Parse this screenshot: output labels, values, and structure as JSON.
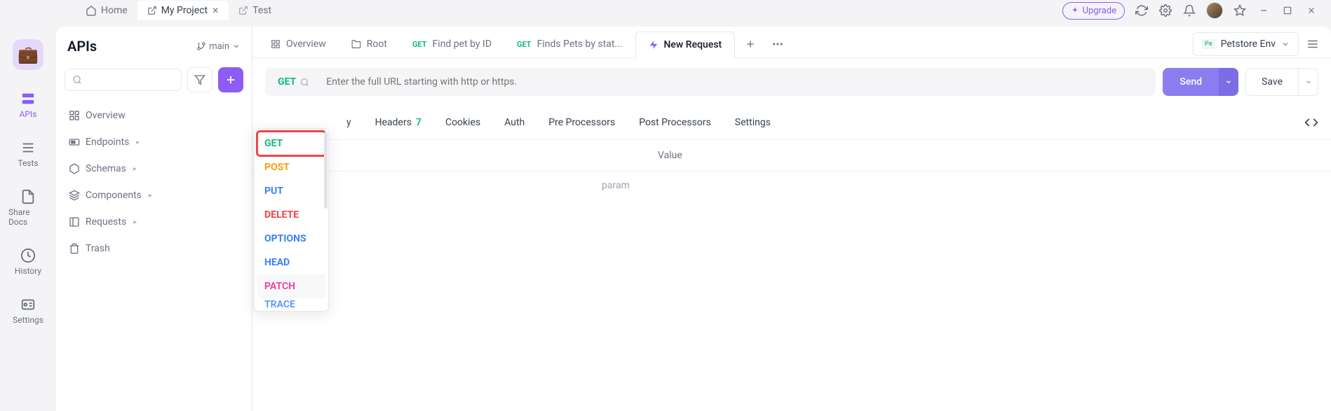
{
  "titlebar": {
    "tabs": [
      {
        "label": "Home",
        "active": false,
        "closeable": false
      },
      {
        "label": "My Project",
        "active": true,
        "closeable": true
      },
      {
        "label": "Test",
        "active": false,
        "closeable": false
      }
    ],
    "upgrade": "Upgrade"
  },
  "rail": {
    "items": [
      {
        "label": "APIs",
        "active": true
      },
      {
        "label": "Tests",
        "active": false
      },
      {
        "label": "Share Docs",
        "active": false
      },
      {
        "label": "History",
        "active": false
      },
      {
        "label": "Settings",
        "active": false
      }
    ]
  },
  "sidepanel": {
    "title": "APIs",
    "branch": "main",
    "tree": [
      {
        "label": "Overview",
        "icon": "overview",
        "expandable": false
      },
      {
        "label": "Endpoints",
        "icon": "endpoints",
        "expandable": true
      },
      {
        "label": "Schemas",
        "icon": "schemas",
        "expandable": true
      },
      {
        "label": "Components",
        "icon": "components",
        "expandable": true
      },
      {
        "label": "Requests",
        "icon": "requests",
        "expandable": true
      },
      {
        "label": "Trash",
        "icon": "trash",
        "expandable": false
      }
    ]
  },
  "request_tabs": [
    {
      "icon": "overview",
      "label": "Overview",
      "method": null,
      "active": false
    },
    {
      "icon": "folder",
      "label": "Root",
      "method": null,
      "active": false
    },
    {
      "icon": null,
      "label": "Find pet by ID",
      "method": "GET",
      "active": false
    },
    {
      "icon": null,
      "label": "Finds Pets by stat...",
      "method": "GET",
      "active": false
    },
    {
      "icon": "bolt",
      "label": "New Request",
      "method": null,
      "active": true
    }
  ],
  "env": {
    "badge": "Pe",
    "label": "Petstore Env"
  },
  "url_bar": {
    "method": "GET",
    "placeholder": "Enter the full URL starting with http or https.",
    "send": "Send",
    "save": "Save"
  },
  "section_tabs": {
    "body_suffix": "y",
    "headers": {
      "label": "Headers",
      "count": "7"
    },
    "cookies": "Cookies",
    "auth": "Auth",
    "pre": "Pre Processors",
    "post": "Post Processors",
    "settings": "Settings"
  },
  "params_table": {
    "col_value": "Value",
    "placeholder_row": "param"
  },
  "method_dropdown": {
    "options": [
      {
        "key": "get",
        "label": "GET"
      },
      {
        "key": "post",
        "label": "POST"
      },
      {
        "key": "put",
        "label": "PUT"
      },
      {
        "key": "delete",
        "label": "DELETE"
      },
      {
        "key": "options",
        "label": "OPTIONS"
      },
      {
        "key": "head",
        "label": "HEAD"
      },
      {
        "key": "patch",
        "label": "PATCH"
      },
      {
        "key": "trace",
        "label": "TRACE"
      }
    ]
  },
  "colors": {
    "accent": "#8b5cf6",
    "get": "#10b981",
    "post": "#f59e0b",
    "put": "#3b82f6",
    "delete": "#ef4444",
    "patch": "#ec4899",
    "highlight_box": "#ef4444"
  }
}
